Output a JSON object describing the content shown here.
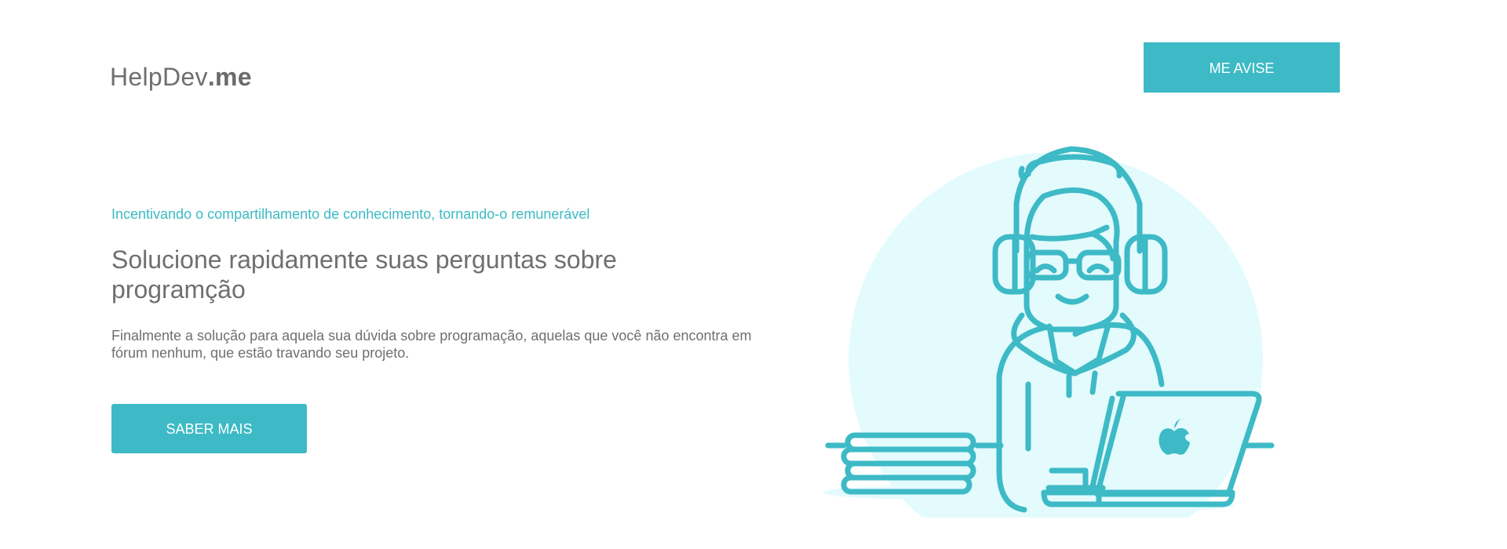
{
  "header": {
    "logo_text": "HelpDev",
    "logo_suffix": ".me",
    "notify_label": "ME AVISE"
  },
  "hero": {
    "tagline": "Incentivando o compartilhamento de conhecimento, tornando-o remunerável",
    "headline": "Solucione rapidamente suas perguntas sobre programção",
    "description": "Finalmente a solução para aquela sua dúvida sobre programação, aquelas que você não encontra em fórum nenhum, que estão travando seu projeto.",
    "cta_label": "SABER MAIS"
  },
  "illustration": {
    "subject": "developer-with-headphones-and-laptop",
    "accent_color": "#3dbac6",
    "background_color": "#e3fbfd"
  },
  "colors": {
    "accent": "#3dbac6",
    "text": "#6f6f6f",
    "background": "#ffffff"
  }
}
